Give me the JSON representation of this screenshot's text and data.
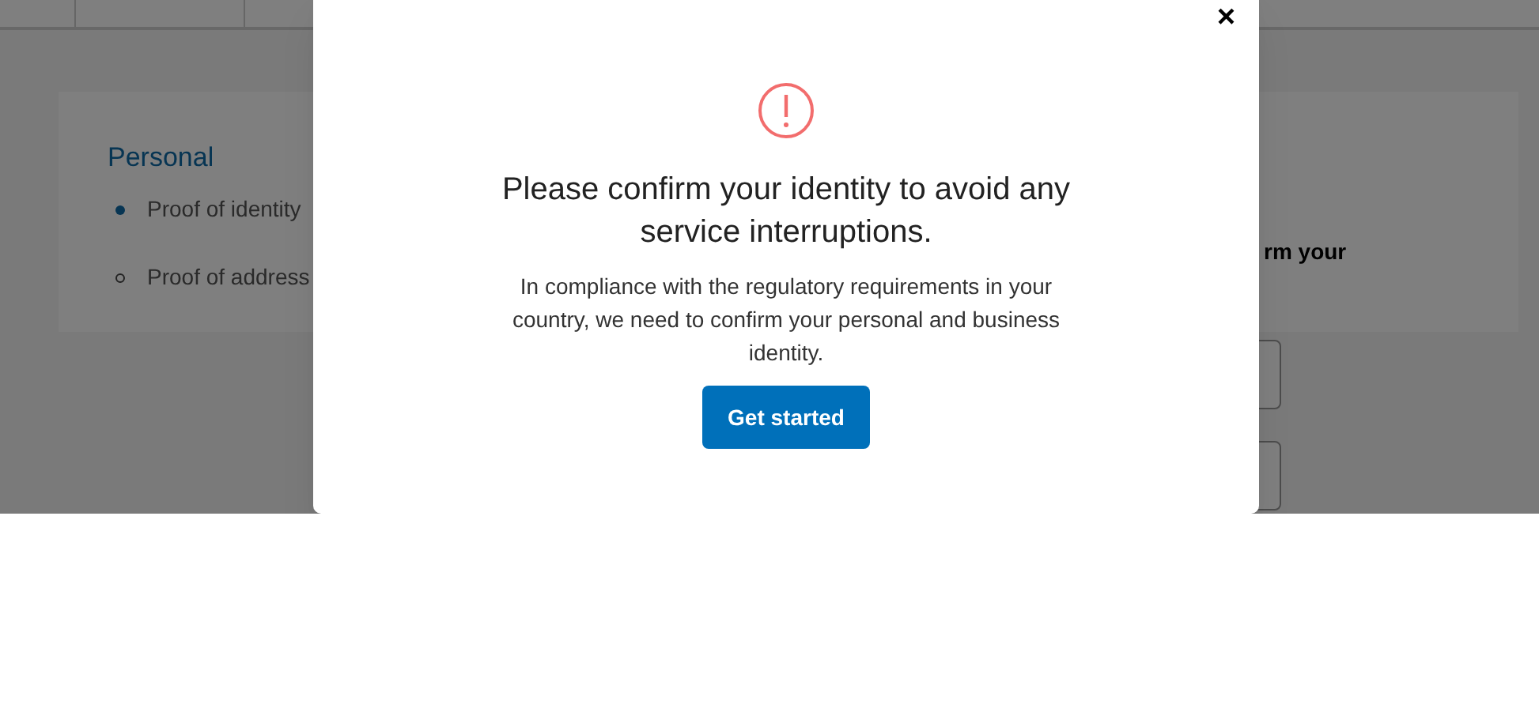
{
  "page": {
    "section_title": "Personal",
    "steps": [
      {
        "label": "Proof of identity",
        "current": true
      },
      {
        "label": "Proof of address",
        "current": false
      }
    ],
    "partial_heading": "rm your",
    "fields": [
      {
        "kind": "input"
      },
      {
        "kind": "input"
      }
    ]
  },
  "modal": {
    "close": "×",
    "title": "Please confirm your identity to avoid any service interruptions.",
    "message": "In compliance with the regulatory requirements in your country, we need to confirm your personal and business identity.",
    "button": "Get started"
  }
}
